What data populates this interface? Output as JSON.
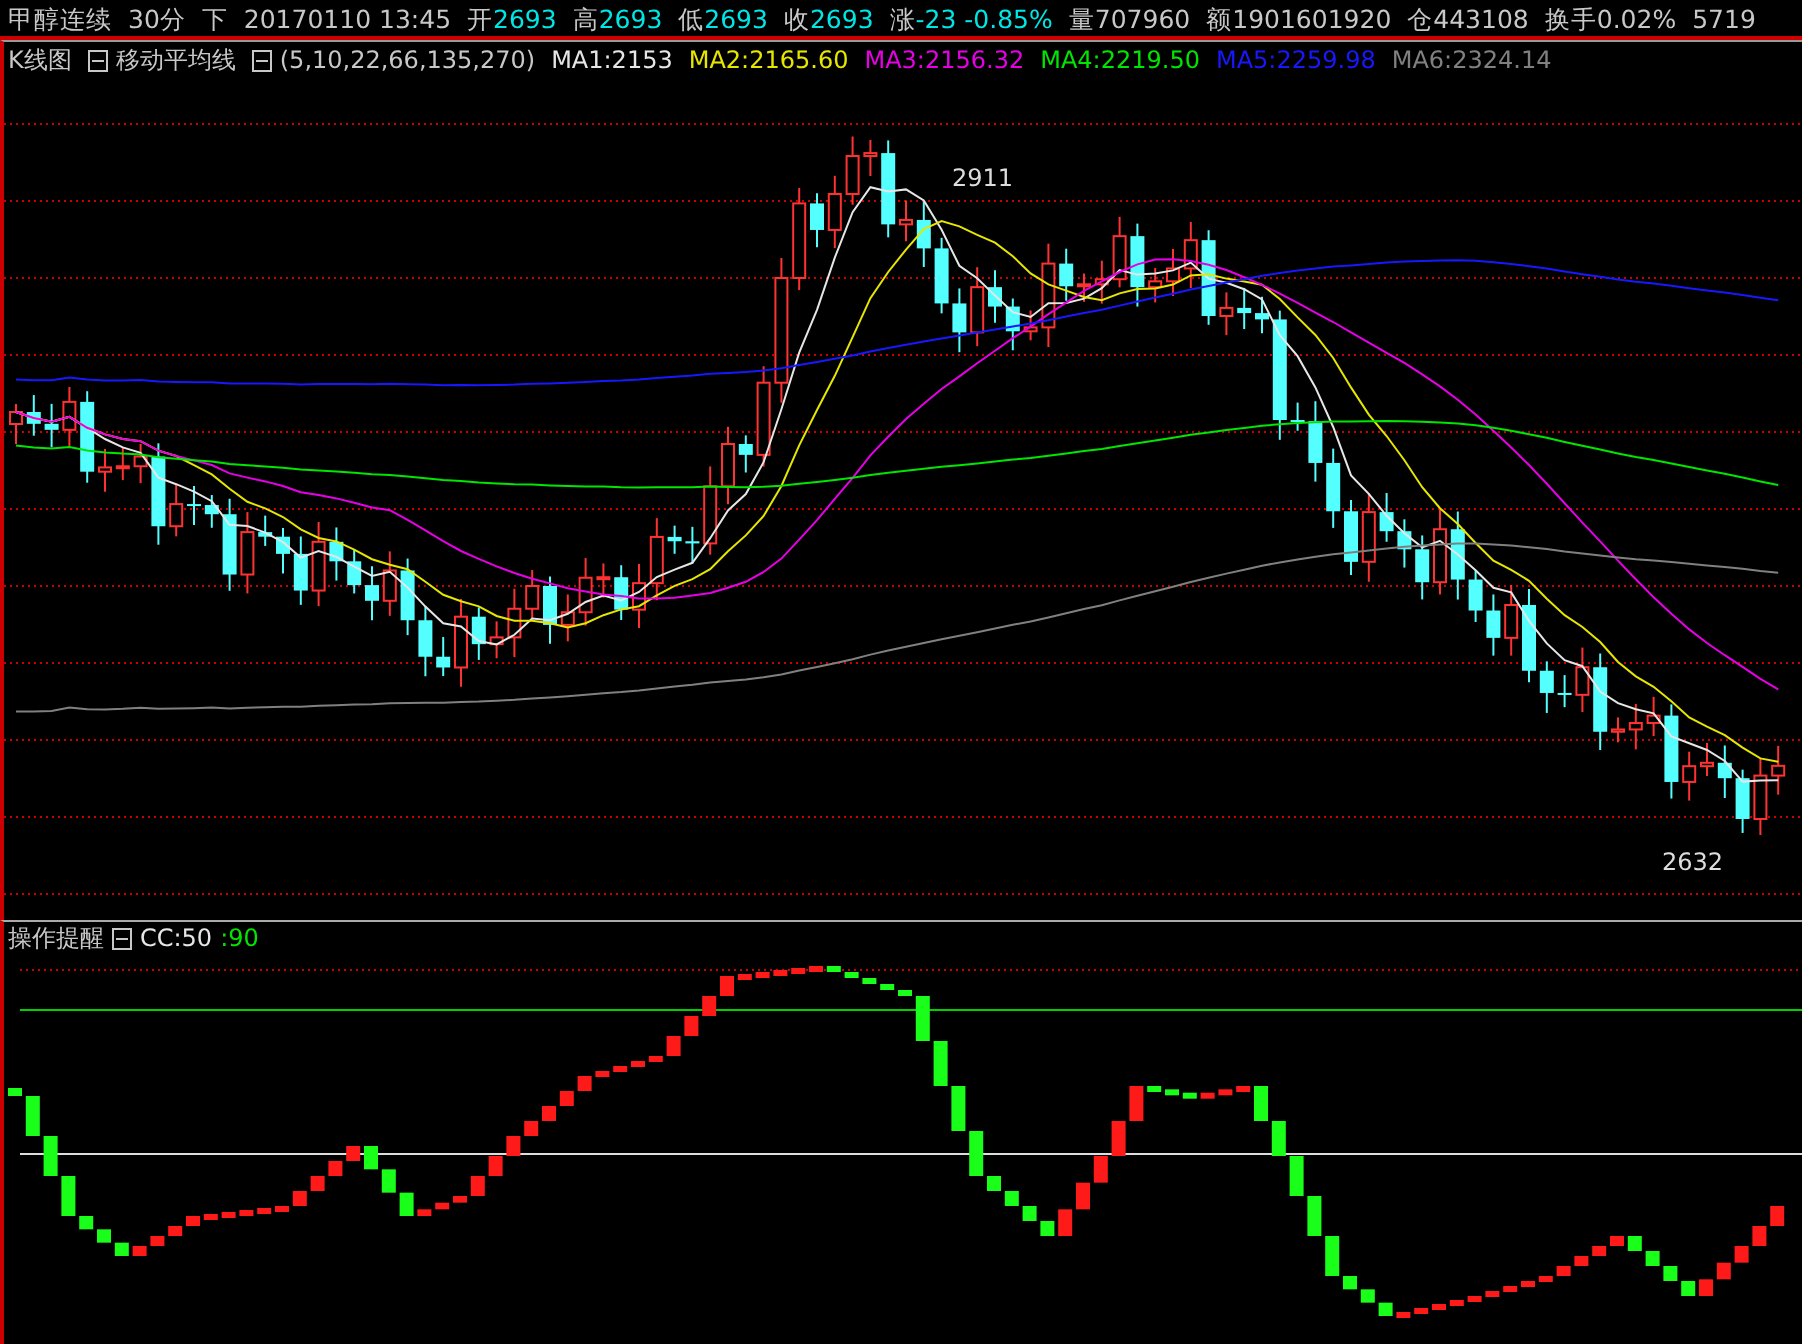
{
  "quote": {
    "name": "甲醇连续",
    "period": "30分",
    "direction": "下",
    "datetime": "20170110 13:45",
    "fields": [
      {
        "label": "开",
        "value": "2693",
        "color": "#00e5e5"
      },
      {
        "label": "高",
        "value": "2693",
        "color": "#00e5e5"
      },
      {
        "label": "低",
        "value": "2693",
        "color": "#00e5e5"
      },
      {
        "label": "收",
        "value": "2693",
        "color": "#00e5e5"
      },
      {
        "label": "涨",
        "value": "-23 -0.85%",
        "color": "#00e5e5"
      },
      {
        "label": "量",
        "value": "707960",
        "color": "#c8c8c8"
      },
      {
        "label": "额",
        "value": "1901601920",
        "color": "#c8c8c8"
      },
      {
        "label": "仓",
        "value": "443108",
        "color": "#c8c8c8"
      },
      {
        "label": "换手",
        "value": "0.02%",
        "color": "#c8c8c8"
      }
    ],
    "extra": "5719"
  },
  "main_panel": {
    "chart_type": "K线图",
    "indicator": "移动平均线",
    "params": "(5,10,22,66,135,270)",
    "averages": [
      {
        "label": "MA1:2153",
        "color": "#e6e6e6"
      },
      {
        "label": "MA2:2165.60",
        "color": "#e6e600"
      },
      {
        "label": "MA3:2156.32",
        "color": "#e600e6"
      },
      {
        "label": "MA4:2219.50",
        "color": "#00e600"
      },
      {
        "label": "MA5:2259.98",
        "color": "#1818ff"
      },
      {
        "label": "MA6:2324.14",
        "color": "#808080"
      }
    ],
    "high_label": "2911",
    "low_label": "2632"
  },
  "sub_panel": {
    "name": "操作提醒",
    "formula": "CC:50",
    "value": ":90"
  }
}
